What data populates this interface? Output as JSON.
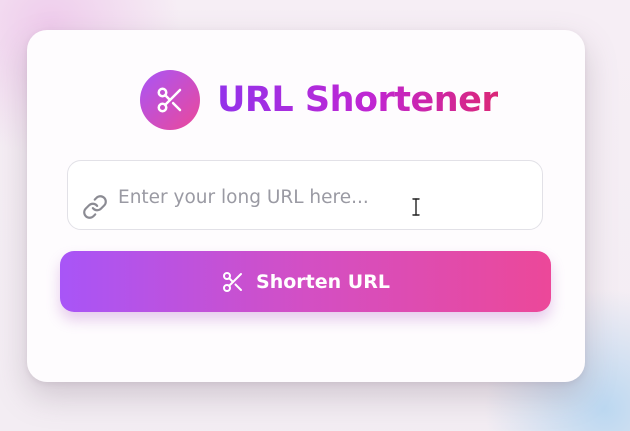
{
  "app": {
    "title": "URL Shortener",
    "logo_icon": "scissors-icon",
    "brand_gradient": [
      "#a855f7",
      "#ec4899"
    ]
  },
  "form": {
    "url_input": {
      "value": "",
      "placeholder": "Enter your long URL here...",
      "icon": "link-icon"
    },
    "submit": {
      "label": "Shorten URL",
      "icon": "scissors-icon"
    }
  },
  "pointer": {
    "icon": "text-cursor-icon"
  }
}
